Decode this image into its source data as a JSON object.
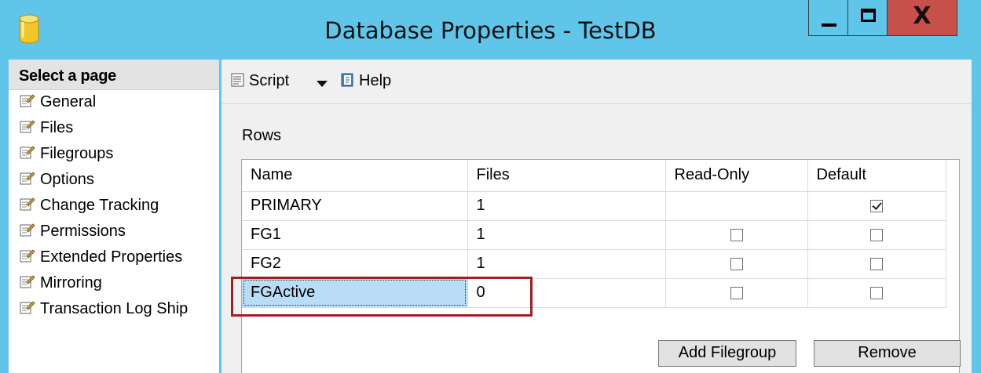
{
  "window": {
    "title": "Database Properties - TestDB",
    "close_glyph": "X"
  },
  "left_pane": {
    "header": "Select a page",
    "items": [
      {
        "label": "General",
        "icon": "page-wrench-icon"
      },
      {
        "label": "Files",
        "icon": "page-wrench-icon"
      },
      {
        "label": "Filegroups",
        "icon": "page-wrench-icon",
        "selected": true
      },
      {
        "label": "Options",
        "icon": "page-wrench-icon"
      },
      {
        "label": "Change Tracking",
        "icon": "page-wrench-icon"
      },
      {
        "label": "Permissions",
        "icon": "page-wrench-icon"
      },
      {
        "label": "Extended Properties",
        "icon": "page-wrench-icon"
      },
      {
        "label": "Mirroring",
        "icon": "page-wrench-icon"
      },
      {
        "label": "Transaction Log Ship",
        "icon": "page-wrench-icon"
      }
    ]
  },
  "toolbar": {
    "script_label": "Script",
    "help_label": "Help"
  },
  "rows_section": {
    "label": "Rows",
    "columns": [
      "Name",
      "Files",
      "Read-Only",
      "Default"
    ],
    "rows": [
      {
        "name": "PRIMARY",
        "files": "1",
        "read_only": null,
        "default": true
      },
      {
        "name": "FG1",
        "files": "1",
        "read_only": false,
        "default": false
      },
      {
        "name": "FG2",
        "files": "1",
        "read_only": false,
        "default": false
      },
      {
        "name": "FGActive",
        "files": "0",
        "read_only": false,
        "default": false,
        "selected": true
      }
    ]
  },
  "buttons": {
    "add_filegroup": "Add Filegroup",
    "remove": "Remove"
  },
  "colors": {
    "titlebar": "#5fc6ea",
    "close_button": "#c7504a",
    "highlight_box": "#a01e24",
    "selected_cell": "#b9ddf7"
  }
}
